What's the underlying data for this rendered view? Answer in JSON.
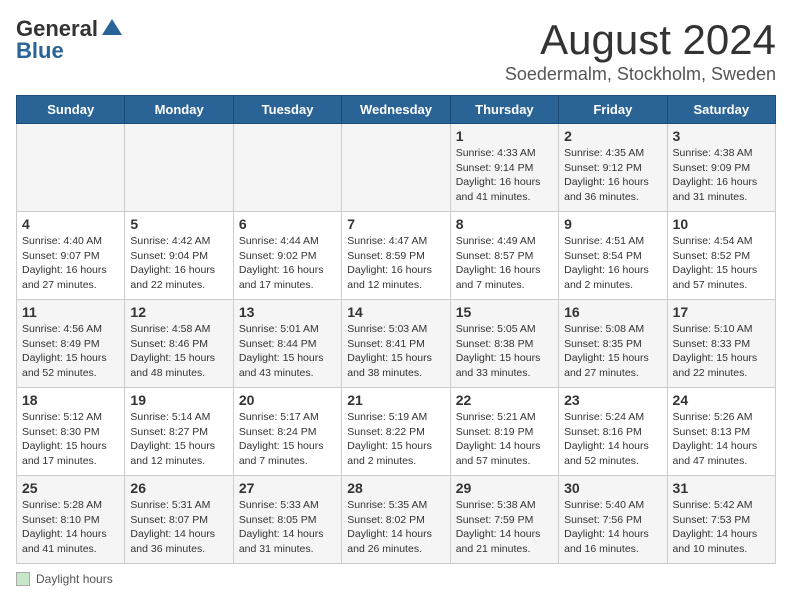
{
  "header": {
    "logo": {
      "general": "General",
      "blue": "Blue"
    },
    "title": "August 2024",
    "subtitle": "Soedermalm, Stockholm, Sweden"
  },
  "days_of_week": [
    "Sunday",
    "Monday",
    "Tuesday",
    "Wednesday",
    "Thursday",
    "Friday",
    "Saturday"
  ],
  "weeks": [
    [
      {
        "day": "",
        "info": ""
      },
      {
        "day": "",
        "info": ""
      },
      {
        "day": "",
        "info": ""
      },
      {
        "day": "",
        "info": ""
      },
      {
        "day": "1",
        "info": "Sunrise: 4:33 AM\nSunset: 9:14 PM\nDaylight: 16 hours\nand 41 minutes."
      },
      {
        "day": "2",
        "info": "Sunrise: 4:35 AM\nSunset: 9:12 PM\nDaylight: 16 hours\nand 36 minutes."
      },
      {
        "day": "3",
        "info": "Sunrise: 4:38 AM\nSunset: 9:09 PM\nDaylight: 16 hours\nand 31 minutes."
      }
    ],
    [
      {
        "day": "4",
        "info": "Sunrise: 4:40 AM\nSunset: 9:07 PM\nDaylight: 16 hours\nand 27 minutes."
      },
      {
        "day": "5",
        "info": "Sunrise: 4:42 AM\nSunset: 9:04 PM\nDaylight: 16 hours\nand 22 minutes."
      },
      {
        "day": "6",
        "info": "Sunrise: 4:44 AM\nSunset: 9:02 PM\nDaylight: 16 hours\nand 17 minutes."
      },
      {
        "day": "7",
        "info": "Sunrise: 4:47 AM\nSunset: 8:59 PM\nDaylight: 16 hours\nand 12 minutes."
      },
      {
        "day": "8",
        "info": "Sunrise: 4:49 AM\nSunset: 8:57 PM\nDaylight: 16 hours\nand 7 minutes."
      },
      {
        "day": "9",
        "info": "Sunrise: 4:51 AM\nSunset: 8:54 PM\nDaylight: 16 hours\nand 2 minutes."
      },
      {
        "day": "10",
        "info": "Sunrise: 4:54 AM\nSunset: 8:52 PM\nDaylight: 15 hours\nand 57 minutes."
      }
    ],
    [
      {
        "day": "11",
        "info": "Sunrise: 4:56 AM\nSunset: 8:49 PM\nDaylight: 15 hours\nand 52 minutes."
      },
      {
        "day": "12",
        "info": "Sunrise: 4:58 AM\nSunset: 8:46 PM\nDaylight: 15 hours\nand 48 minutes."
      },
      {
        "day": "13",
        "info": "Sunrise: 5:01 AM\nSunset: 8:44 PM\nDaylight: 15 hours\nand 43 minutes."
      },
      {
        "day": "14",
        "info": "Sunrise: 5:03 AM\nSunset: 8:41 PM\nDaylight: 15 hours\nand 38 minutes."
      },
      {
        "day": "15",
        "info": "Sunrise: 5:05 AM\nSunset: 8:38 PM\nDaylight: 15 hours\nand 33 minutes."
      },
      {
        "day": "16",
        "info": "Sunrise: 5:08 AM\nSunset: 8:35 PM\nDaylight: 15 hours\nand 27 minutes."
      },
      {
        "day": "17",
        "info": "Sunrise: 5:10 AM\nSunset: 8:33 PM\nDaylight: 15 hours\nand 22 minutes."
      }
    ],
    [
      {
        "day": "18",
        "info": "Sunrise: 5:12 AM\nSunset: 8:30 PM\nDaylight: 15 hours\nand 17 minutes."
      },
      {
        "day": "19",
        "info": "Sunrise: 5:14 AM\nSunset: 8:27 PM\nDaylight: 15 hours\nand 12 minutes."
      },
      {
        "day": "20",
        "info": "Sunrise: 5:17 AM\nSunset: 8:24 PM\nDaylight: 15 hours\nand 7 minutes."
      },
      {
        "day": "21",
        "info": "Sunrise: 5:19 AM\nSunset: 8:22 PM\nDaylight: 15 hours\nand 2 minutes."
      },
      {
        "day": "22",
        "info": "Sunrise: 5:21 AM\nSunset: 8:19 PM\nDaylight: 14 hours\nand 57 minutes."
      },
      {
        "day": "23",
        "info": "Sunrise: 5:24 AM\nSunset: 8:16 PM\nDaylight: 14 hours\nand 52 minutes."
      },
      {
        "day": "24",
        "info": "Sunrise: 5:26 AM\nSunset: 8:13 PM\nDaylight: 14 hours\nand 47 minutes."
      }
    ],
    [
      {
        "day": "25",
        "info": "Sunrise: 5:28 AM\nSunset: 8:10 PM\nDaylight: 14 hours\nand 41 minutes."
      },
      {
        "day": "26",
        "info": "Sunrise: 5:31 AM\nSunset: 8:07 PM\nDaylight: 14 hours\nand 36 minutes."
      },
      {
        "day": "27",
        "info": "Sunrise: 5:33 AM\nSunset: 8:05 PM\nDaylight: 14 hours\nand 31 minutes."
      },
      {
        "day": "28",
        "info": "Sunrise: 5:35 AM\nSunset: 8:02 PM\nDaylight: 14 hours\nand 26 minutes."
      },
      {
        "day": "29",
        "info": "Sunrise: 5:38 AM\nSunset: 7:59 PM\nDaylight: 14 hours\nand 21 minutes."
      },
      {
        "day": "30",
        "info": "Sunrise: 5:40 AM\nSunset: 7:56 PM\nDaylight: 14 hours\nand 16 minutes."
      },
      {
        "day": "31",
        "info": "Sunrise: 5:42 AM\nSunset: 7:53 PM\nDaylight: 14 hours\nand 10 minutes."
      }
    ]
  ],
  "legend": {
    "label": "Daylight hours"
  }
}
